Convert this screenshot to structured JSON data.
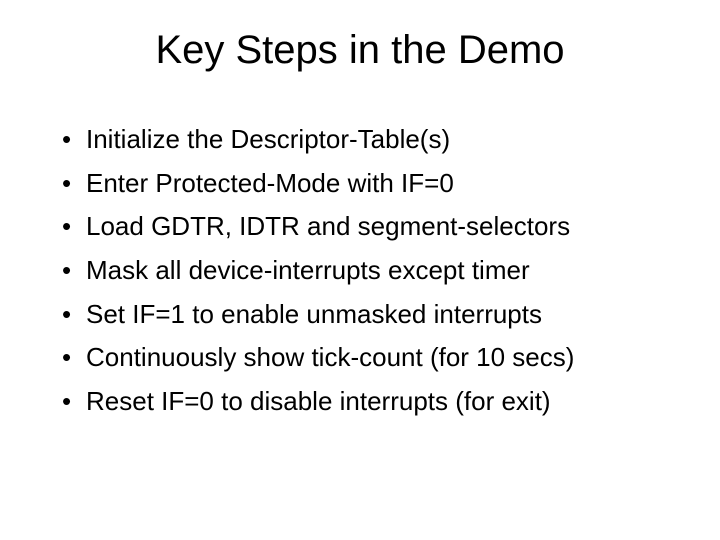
{
  "title": "Key Steps in the Demo",
  "bullets": [
    "Initialize the Descriptor-Table(s)",
    "Enter Protected-Mode with IF=0",
    "Load GDTR, IDTR and segment-selectors",
    "Mask all device-interrupts except timer",
    "Set IF=1 to enable unmasked interrupts",
    "Continuously show tick-count (for 10 secs)",
    "Reset IF=0 to disable interrupts (for exit)"
  ]
}
